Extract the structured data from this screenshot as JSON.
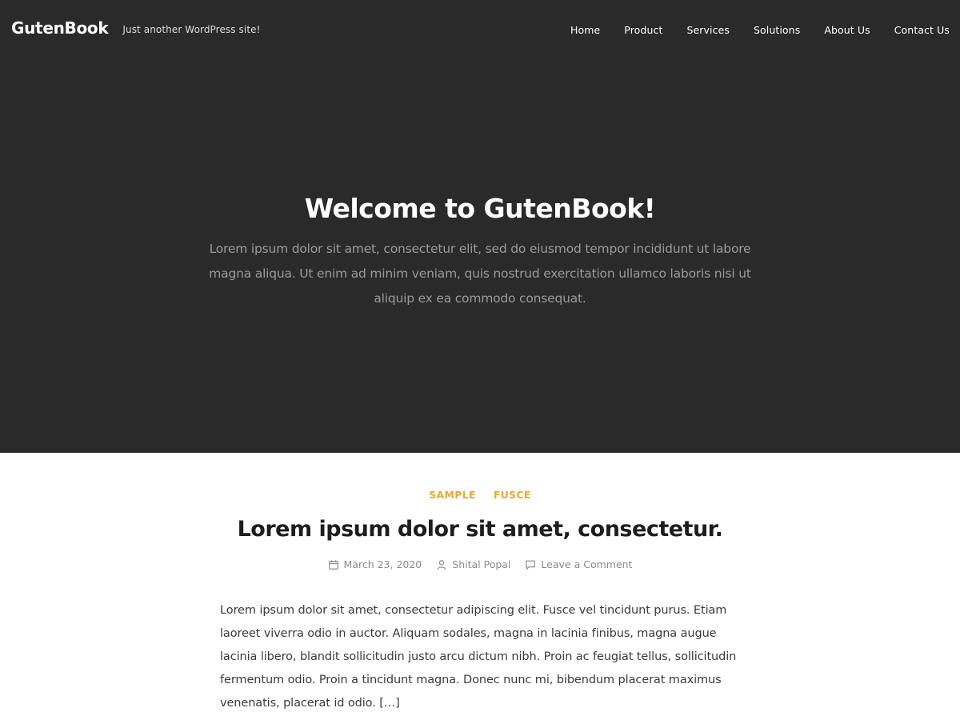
{
  "header": {
    "site_title": "GutenBook",
    "tagline": "Just another WordPress site!",
    "nav": [
      {
        "label": "Home"
      },
      {
        "label": "Product"
      },
      {
        "label": "Services"
      },
      {
        "label": "Solutions"
      },
      {
        "label": "About Us"
      },
      {
        "label": "Contact Us"
      }
    ]
  },
  "hero": {
    "title": "Welcome to GutenBook!",
    "text": "Lorem ipsum dolor sit amet, consectetur elit, sed do eiusmod tempor incididunt ut labore magna aliqua. Ut enim ad minim veniam, quis nostrud exercitation ullamco laboris nisi ut aliquip ex ea commodo consequat."
  },
  "post": {
    "categories": [
      {
        "label": "SAMPLE"
      },
      {
        "label": "FUSCE"
      }
    ],
    "title": "Lorem ipsum dolor sit amet, consectetur.",
    "meta": {
      "date": "March 23, 2020",
      "author": "Shital Popal",
      "comments": "Leave a Comment"
    },
    "excerpt": "Lorem ipsum dolor sit amet, consectetur adipiscing elit. Fusce vel tincidunt purus. Etiam laoreet viverra odio in auctor. Aliquam sodales, magna in lacinia finibus, magna augue lacinia libero, blandit sollicitudin justo arcu dictum nibh. Proin ac feugiat tellus, sollicitudin fermentum odio. Proin a tincidunt magna. Donec nunc mi, bibendum placerat maximus venenatis, placerat id odio. […]"
  },
  "colors": {
    "hero_background": "#2a2a2b",
    "accent": "#e1ab3a",
    "meta_text": "#8a8a8a"
  },
  "icons": {
    "date": "calendar-icon",
    "author": "user-icon",
    "comments": "comment-icon"
  }
}
